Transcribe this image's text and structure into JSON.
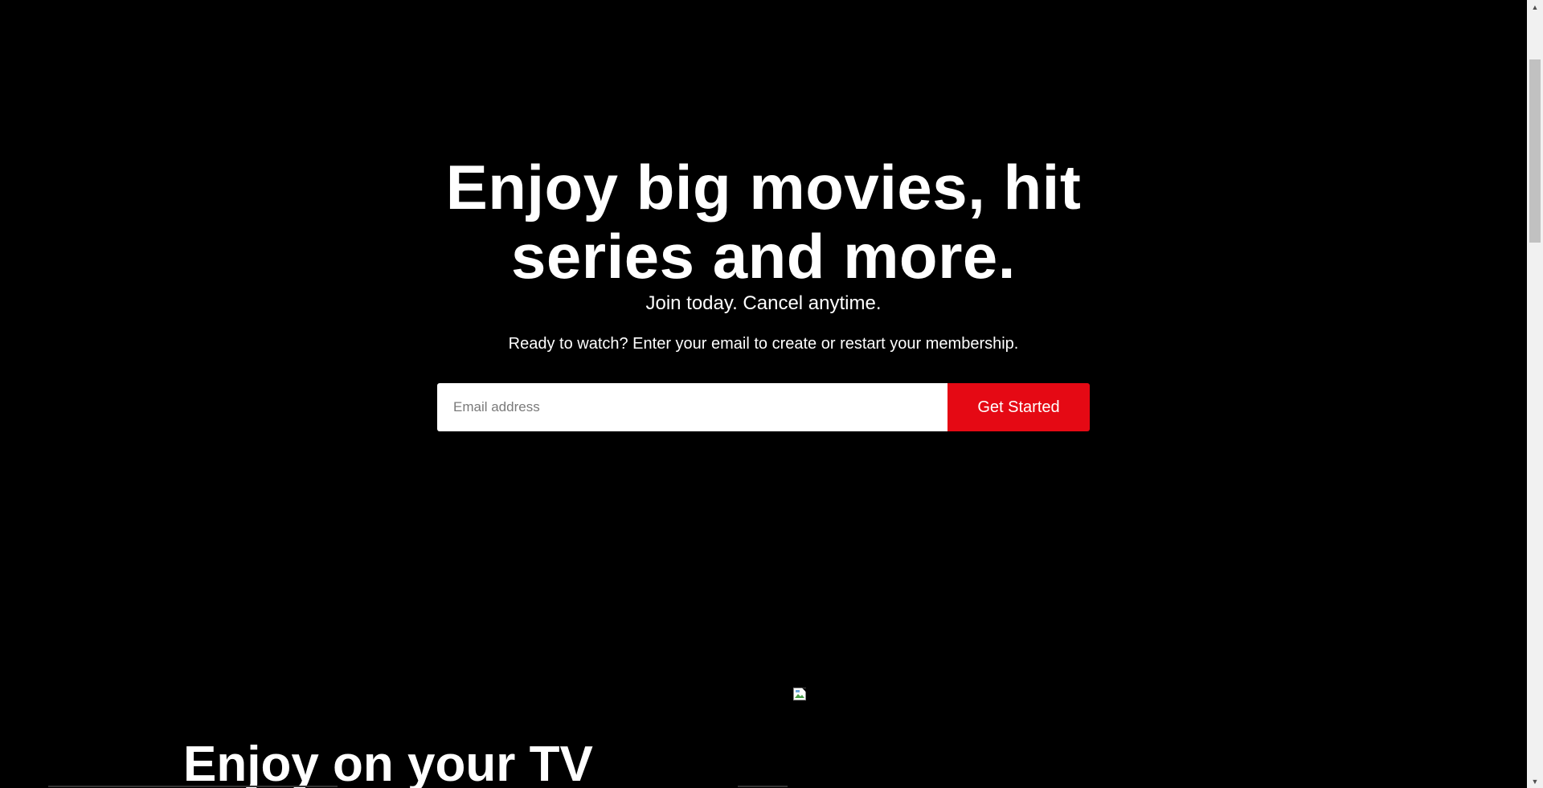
{
  "hero": {
    "title": "Enjoy big movies, hit series and more.",
    "subtitle": "Join today. Cancel anytime.",
    "prompt": "Ready to watch? Enter your email to create or restart your membership."
  },
  "signup": {
    "email_placeholder": "Email address",
    "email_value": "",
    "button_label": "Get Started"
  },
  "feature": {
    "title": "Enjoy on your TV"
  },
  "icons": {
    "broken_image": "broken-image-icon",
    "scroll_up": "triangle-up-icon",
    "scroll_down": "triangle-down-icon"
  },
  "colors": {
    "background": "#000000",
    "accent": "#e50914",
    "text": "#ffffff"
  }
}
